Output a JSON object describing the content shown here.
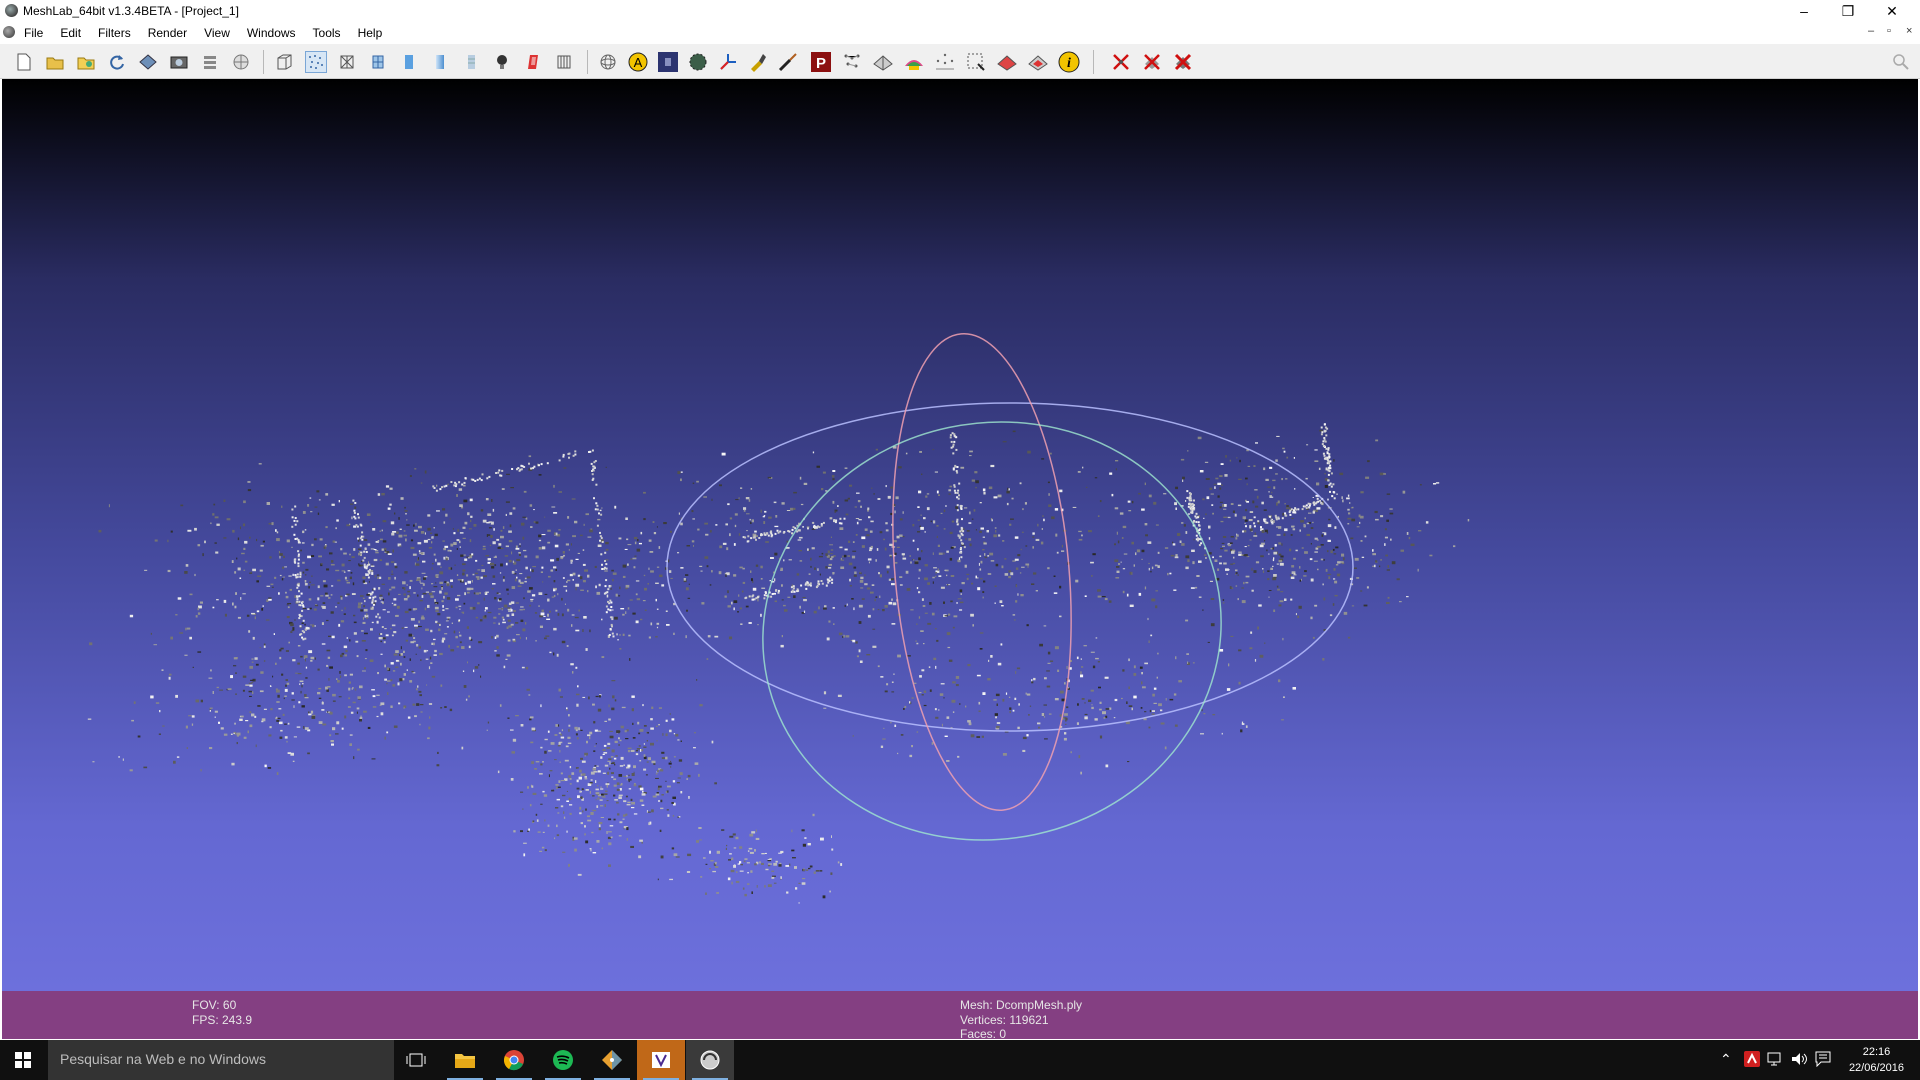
{
  "window": {
    "title": "MeshLab_64bit v1.3.4BETA - [Project_1]",
    "controls": {
      "minimize": "–",
      "restore": "❐",
      "close": "✕"
    }
  },
  "menu": {
    "items": [
      "File",
      "Edit",
      "Filters",
      "Render",
      "View",
      "Windows",
      "Tools",
      "Help"
    ],
    "mdi_controls": {
      "minimize": "–",
      "restore": "▫",
      "close": "×"
    }
  },
  "toolbar": {
    "groups": [
      [
        "new-project-icon",
        "open-project-icon",
        "open-mesh-icon",
        "reload-icon",
        "save-icon",
        "snapshot-icon",
        "layers-icon",
        "render-mode-icon"
      ],
      [
        "bounding-box-icon",
        "points-icon",
        "wireframe-icon",
        "hidden-lines-icon",
        "flat-icon",
        "smooth-icon",
        "texture-icon",
        "light-icon",
        "color-icon",
        "layer-dialog-icon"
      ],
      [
        "manipulator-icon",
        "annotation-icon",
        "raster-icon",
        "sphere-icon",
        "measure-icon",
        "paint-icon",
        "brush-icon",
        "pick-points-icon",
        "align-icon",
        "mesh-edit-icon",
        "z-paint-icon",
        "reference-icon",
        "select-vertices-icon",
        "select-faces-icon",
        "select-connected-icon",
        "info-icon"
      ],
      [
        "delete-selection-icon",
        "delete-faces-icon",
        "delete-vertices-icon"
      ]
    ],
    "search_icon": "magnifier-icon",
    "accent": "#f2c400"
  },
  "viewport": {
    "background_top": "#000000",
    "background_bottom": "#6d70dc",
    "trackball_colors": {
      "horizontal": "#b8c0ff",
      "vertical": "#f0a0b0",
      "tilt": "#a0e8d0"
    }
  },
  "info": {
    "fov_label": "FOV: 60",
    "fps_label": "FPS:   243.9",
    "mesh_label": "Mesh: DcompMesh.ply",
    "vertices_label": "Vertices: 119621",
    "faces_label": "Faces: 0"
  },
  "taskbar": {
    "search_placeholder": "Pesquisar na Web e no Windows",
    "apps": [
      "task-view-icon",
      "file-explorer-icon",
      "chrome-icon",
      "spotify-icon",
      "git-icon",
      "visual-studio-icon",
      "meshlab-icon"
    ],
    "time": "22:16",
    "date": "22/06/2016"
  }
}
